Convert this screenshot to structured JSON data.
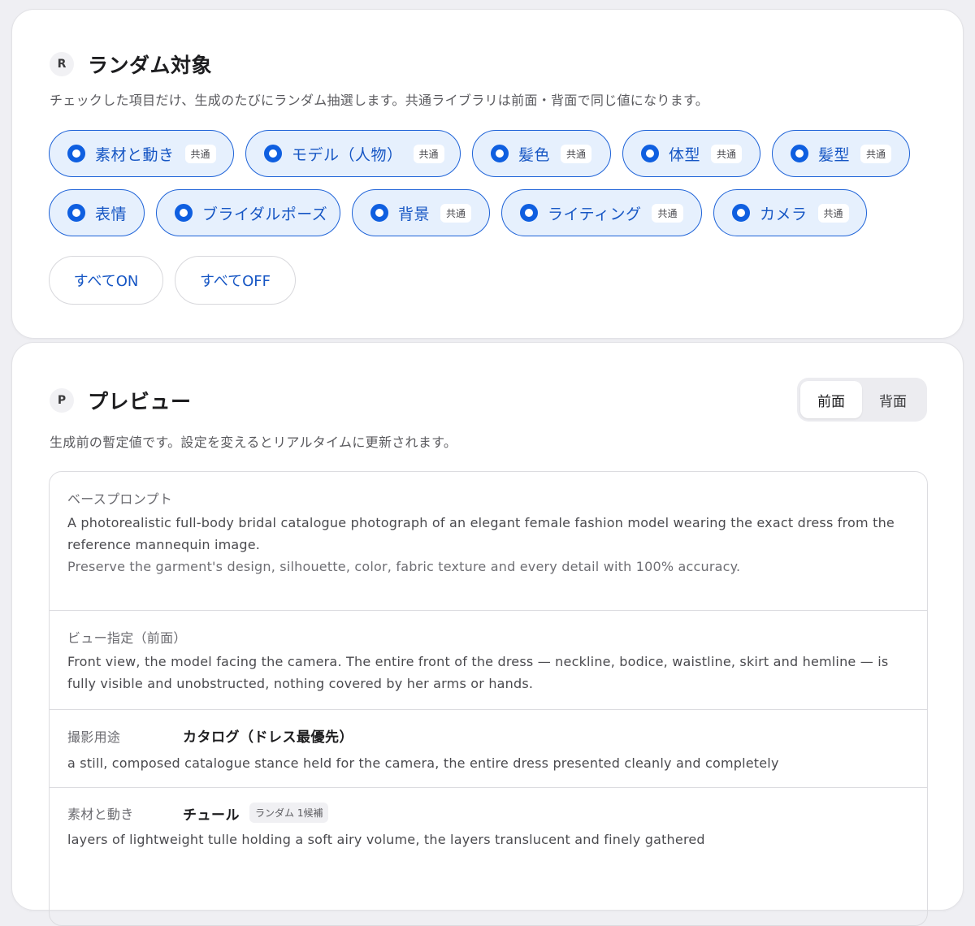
{
  "random_section": {
    "letter": "R",
    "title": "ランダム対象",
    "description": "チェックした項目だけ、生成のたびにランダム抽選します。共通ライブラリは前面・背面で同じ値になります。",
    "chips": [
      {
        "label": "素材と動き",
        "tag": "共通"
      },
      {
        "label": "モデル（人物）",
        "tag": "共通"
      },
      {
        "label": "髪色",
        "tag": "共通"
      },
      {
        "label": "体型",
        "tag": "共通"
      },
      {
        "label": "髪型",
        "tag": "共通"
      },
      {
        "label": "表情"
      },
      {
        "label": "ブライダルポーズ"
      },
      {
        "label": "背景",
        "tag": "共通"
      },
      {
        "label": "ライティング",
        "tag": "共通"
      },
      {
        "label": "カメラ",
        "tag": "共通"
      }
    ],
    "all_on_label": "すべてON",
    "all_off_label": "すべてOFF"
  },
  "preview_section": {
    "letter": "P",
    "title": "プレビュー",
    "description": "生成前の暫定値です。設定を変えるとリアルタイムに更新されます。",
    "toggle": {
      "front": "前面",
      "back": "背面",
      "active": "前面"
    },
    "base_prompt": {
      "label": "ベースプロンプト",
      "line1": "A photorealistic full-body bridal catalogue photograph of an elegant female fashion model wearing the exact dress from the reference mannequin image.",
      "line2": "Preserve the garment's design, silhouette, color, fabric texture and every detail with 100% accuracy."
    },
    "view": {
      "label": "ビュー指定（前面）",
      "text": "Front view, the model facing the camera. The entire front of the dress — neckline, bodice, waistline, skirt and hemline — is fully visible and unobstructed, nothing covered by her arms or hands."
    },
    "usage": {
      "label": "撮影用途",
      "value": "カタログ（ドレス最優先）",
      "text": "a still, composed catalogue stance held for the camera, the entire dress presented cleanly and completely"
    },
    "material": {
      "label": "素材と動き",
      "value": "チュール",
      "tag": "ランダム 1候補",
      "text": "layers of lightweight tulle holding a soft airy volume, the layers translucent and finely gathered"
    }
  },
  "colors": {
    "accent": "#1656c4",
    "chip_bg": "#e6f0fd",
    "chip_border": "#1e63d8",
    "page_bg": "#efeff3"
  }
}
